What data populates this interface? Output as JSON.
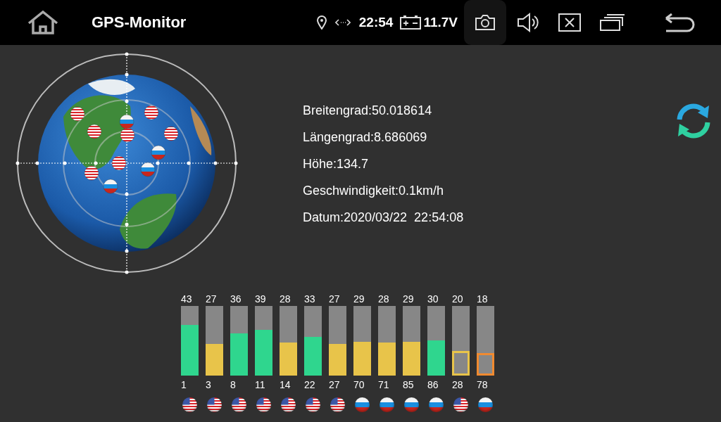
{
  "header": {
    "title": "GPS-Monitor",
    "time": "22:54",
    "voltage": "11.7V"
  },
  "position": [
    {
      "text": "Breitengrad:50.018614"
    },
    {
      "text": "Längengrad:8.686069"
    },
    {
      "text": "Höhe:134.7"
    },
    {
      "text": "Geschwindigkeit:0.1km/h"
    },
    {
      "text": "Datum:2020/03/22  22:54:08"
    }
  ],
  "satellites": [
    {
      "snr": "43",
      "id": "1",
      "level": 0.73,
      "kind": "filled",
      "color": "#2fd68e",
      "flag": {
        "kind": "us"
      }
    },
    {
      "snr": "27",
      "id": "3",
      "level": 0.45,
      "kind": "filled",
      "color": "#e8c44a",
      "flag": {
        "kind": "us"
      }
    },
    {
      "snr": "36",
      "id": "8",
      "level": 0.61,
      "kind": "filled",
      "color": "#2fd68e",
      "flag": {
        "kind": "us"
      }
    },
    {
      "snr": "39",
      "id": "11",
      "level": 0.66,
      "kind": "filled",
      "color": "#2fd68e",
      "flag": {
        "kind": "us"
      }
    },
    {
      "snr": "28",
      "id": "14",
      "level": 0.47,
      "kind": "filled",
      "color": "#e8c44a",
      "flag": {
        "kind": "us"
      }
    },
    {
      "snr": "33",
      "id": "22",
      "level": 0.56,
      "kind": "filled",
      "color": "#2fd68e",
      "flag": {
        "kind": "us"
      }
    },
    {
      "snr": "27",
      "id": "27",
      "level": 0.45,
      "kind": "filled",
      "color": "#e8c44a",
      "flag": {
        "kind": "us"
      }
    },
    {
      "snr": "29",
      "id": "70",
      "level": 0.49,
      "kind": "filled",
      "color": "#e8c44a",
      "flag": {
        "kind": "ru"
      }
    },
    {
      "snr": "28",
      "id": "71",
      "level": 0.47,
      "kind": "filled",
      "color": "#e8c44a",
      "flag": {
        "kind": "ru"
      }
    },
    {
      "snr": "29",
      "id": "85",
      "level": 0.49,
      "kind": "filled",
      "color": "#e8c44a",
      "flag": {
        "kind": "ru"
      }
    },
    {
      "snr": "30",
      "id": "86",
      "level": 0.51,
      "kind": "filled",
      "color": "#2fd68e",
      "flag": {
        "kind": "ru"
      }
    },
    {
      "snr": "20",
      "id": "28",
      "level": 0.35,
      "kind": "outline",
      "color": "#e8c44a",
      "flag": {
        "kind": "us"
      }
    },
    {
      "snr": "18",
      "id": "78",
      "level": 0.32,
      "kind": "outline",
      "color": "#f08a30",
      "flag": {
        "kind": "ru"
      }
    }
  ]
}
